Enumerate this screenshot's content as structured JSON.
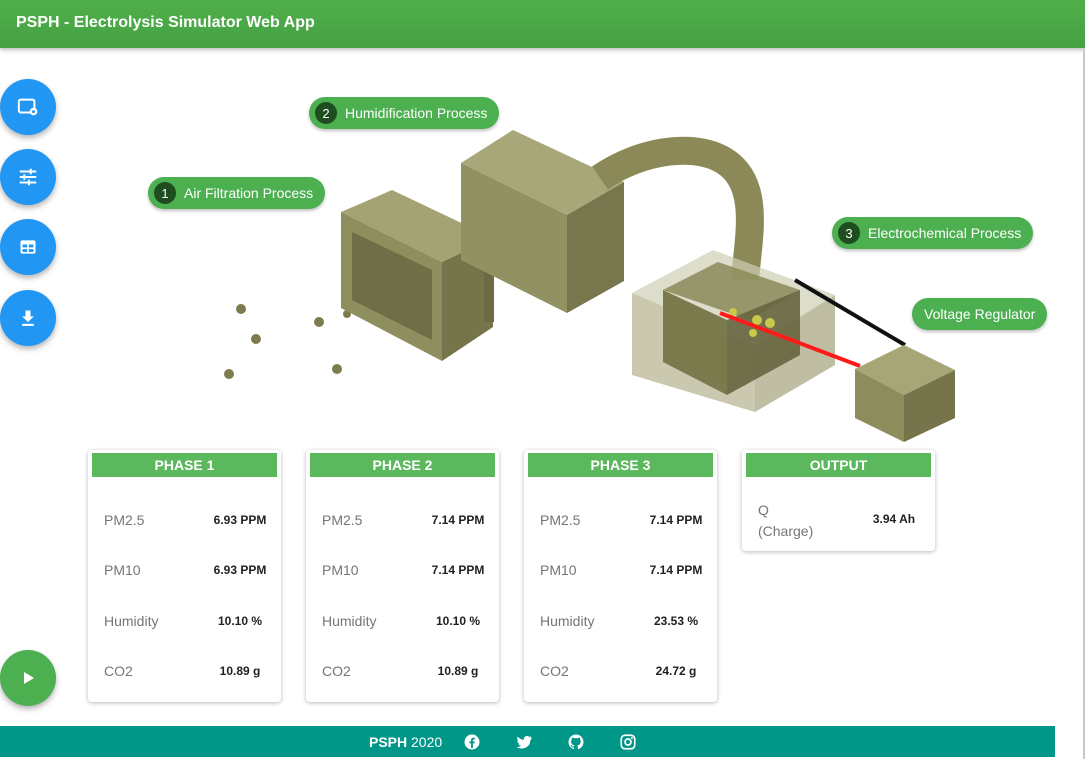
{
  "app": {
    "title": "PSPH - Electrolysis Simulator Web App"
  },
  "sidebar": {
    "buttons": [
      {
        "icon": "settings-window-icon"
      },
      {
        "icon": "tune-sliders-icon"
      },
      {
        "icon": "table-icon"
      },
      {
        "icon": "download-icon"
      }
    ],
    "play": {
      "icon": "play-icon"
    }
  },
  "diagram": {
    "labels": {
      "air_filtration": {
        "num": "1",
        "text": "Air Filtration Process"
      },
      "humidification": {
        "num": "2",
        "text": "Humidification Process"
      },
      "electrochemical": {
        "num": "3",
        "text": "Electrochemical Process"
      },
      "voltage_regulator": {
        "text": "Voltage Regulator"
      }
    },
    "colors": {
      "olive": "#8b8a5a",
      "olive_dark": "#6e6d44",
      "wire_red": "#ff1a1a",
      "wire_black": "#111111"
    }
  },
  "phases": [
    {
      "title": "PHASE 1",
      "rows": [
        {
          "label": "PM2.5",
          "value": "6.93 PPM"
        },
        {
          "label": "PM10",
          "value": "6.93 PPM"
        },
        {
          "label": "Humidity",
          "value": "10.10 %"
        },
        {
          "label": "CO2",
          "value": "10.89 g"
        }
      ]
    },
    {
      "title": "PHASE 2",
      "rows": [
        {
          "label": "PM2.5",
          "value": "7.14 PPM"
        },
        {
          "label": "PM10",
          "value": "7.14 PPM"
        },
        {
          "label": "Humidity",
          "value": "10.10 %"
        },
        {
          "label": "CO2",
          "value": "10.89 g"
        }
      ]
    },
    {
      "title": "PHASE 3",
      "rows": [
        {
          "label": "PM2.5",
          "value": "7.14 PPM"
        },
        {
          "label": "PM10",
          "value": "7.14 PPM"
        },
        {
          "label": "Humidity",
          "value": "23.53 %"
        },
        {
          "label": "CO2",
          "value": "24.72 g"
        }
      ]
    }
  ],
  "output": {
    "title": "OUTPUT",
    "label_line1": "Q",
    "label_line2": "(Charge)",
    "value": "3.94 Ah"
  },
  "footer": {
    "brand": "PSPH",
    "year": "2020",
    "icons": [
      "facebook-icon",
      "twitter-icon",
      "github-icon",
      "instagram-icon"
    ]
  },
  "theme": {
    "appbar": "#4caf50",
    "fab_blue": "#2196f3",
    "footer": "#009688",
    "card_header": "#5cb85c"
  }
}
